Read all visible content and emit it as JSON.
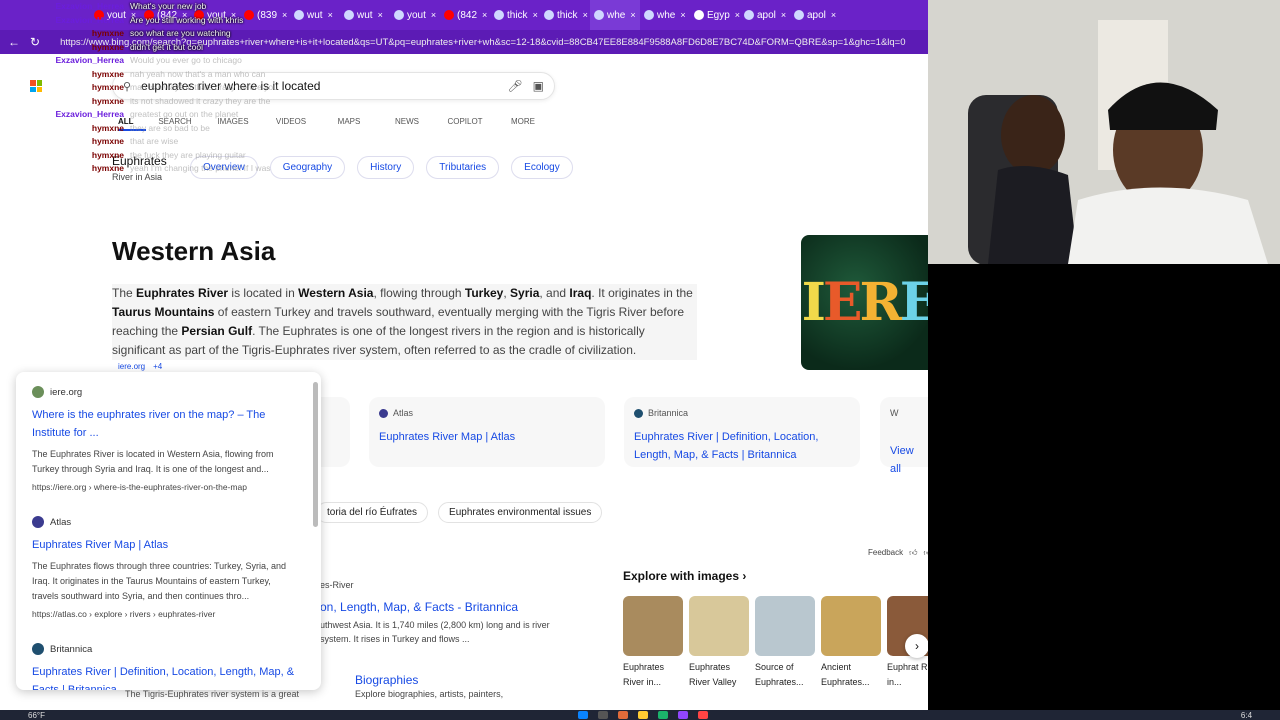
{
  "browser": {
    "tabs": [
      {
        "label": "yout",
        "icon_color": "#ff0000"
      },
      {
        "label": "(842",
        "icon_color": "#ff0000"
      },
      {
        "label": "yout",
        "icon_color": "#ff0000"
      },
      {
        "label": "(839",
        "icon_color": "#ff0000"
      },
      {
        "label": "wut",
        "icon_color": "#cfd8ff"
      },
      {
        "label": "wut",
        "icon_color": "#cfd8ff"
      },
      {
        "label": "yout",
        "icon_color": "#cfd8ff"
      },
      {
        "label": "(842",
        "icon_color": "#ff0000"
      },
      {
        "label": "thick",
        "icon_color": "#cfd8ff"
      },
      {
        "label": "thick",
        "icon_color": "#cfd8ff"
      },
      {
        "label": "whe",
        "icon_color": "#cfd8ff"
      },
      {
        "label": "whe",
        "icon_color": "#cfd8ff"
      },
      {
        "label": "Egyp",
        "icon_color": "#ffffff"
      },
      {
        "label": "apol",
        "icon_color": "#cfd8ff"
      },
      {
        "label": "apol",
        "icon_color": "#cfd8ff"
      }
    ],
    "url": "https://www.bing.com/search?q=euphrates+river+where+is+it+located&qs=UT&pq=euphrates+river+wh&sc=12-18&cvid=88CB47EE8E884F9588A8FD6D8E7BC74D&FORM=QBRE&sp=1&ghc=1&lq=0"
  },
  "bing": {
    "query": "euphrates river where is it located",
    "scopes": [
      "ALL",
      "SEARCH",
      "IMAGES",
      "VIDEOS",
      "MAPS",
      "NEWS",
      "COPILOT",
      "MORE"
    ],
    "entity_title": "Euphrates",
    "entity_sub": "River in Asia",
    "pills": [
      "Overview",
      "Geography",
      "History",
      "Tributaries",
      "Ecology"
    ],
    "answer": "Western Asia",
    "paragraph": {
      "p1": "The ",
      "b1": "Euphrates River",
      "p2": " is located in ",
      "b2": "Western Asia",
      "p3": ", flowing through ",
      "b3": "Turkey",
      "p4": ", ",
      "b4": "Syria",
      "p5": ", and ",
      "b5": "Iraq",
      "p6": ". It originates in the ",
      "b6": "Taurus Mountains",
      "p7": " of eastern Turkey and travels southward, eventually merging with the Tigris River before reaching the ",
      "b7": "Persian Gulf",
      "p8": ". The Euphrates is one of the longest rivers in the region and is historically significant as part of the Tigris-Euphrates river system, often referred to as the cradle of civilization."
    },
    "citations": [
      "iere.org",
      "+4"
    ],
    "thumb_text": "IERE",
    "cards": [
      {
        "source": "",
        "title": "? –"
      },
      {
        "source": "Atlas",
        "title": "Euphrates River Map | Atlas"
      },
      {
        "source": "Britannica",
        "title": "Euphrates River | Definition, Location, Length, Map, & Facts | Britannica"
      },
      {
        "source": "W",
        "title": "View all"
      }
    ],
    "related": [
      "toria del río Éufrates",
      "Euphrates environmental issues"
    ],
    "feedback": "Feedback",
    "explore_title": "Explore with images",
    "images": [
      {
        "caption": "Euphrates River in...",
        "color": "#a98b5e"
      },
      {
        "caption": "Euphrates River Valley",
        "color": "#d8c89a"
      },
      {
        "caption": "Source of Euphrates...",
        "color": "#b9c7cf"
      },
      {
        "caption": "Ancient Euphrates...",
        "color": "#c9a55b"
      },
      {
        "caption": "Euphrat River in...",
        "color": "#8a5a3a"
      }
    ],
    "lower": {
      "src": "es-River",
      "title": "on, Length, Map, & Facts - Britannica",
      "body": "uthwest Asia. It is 1,740 miles (2,800 km) long and is river system. It rises in Turkey and flows ...",
      "bio_title": "Biographies",
      "bio_sub": "Explore biographies, artists, painters,",
      "foot": "The Tigris-Euphrates river system is a great"
    }
  },
  "popup": [
    {
      "source": "iere.org",
      "title": "Where is the euphrates river on the map? – The Institute for ...",
      "body": "The Euphrates River is located in Western Asia, flowing from Turkey through Syria and Iraq. It is one of the longest and...",
      "url": "https://iere.org › where-is-the-euphrates-river-on-the-map",
      "color": "#6b8f5a"
    },
    {
      "source": "Atlas",
      "title": "Euphrates River Map | Atlas",
      "body": "The Euphrates flows through three countries: Turkey, Syria, and Iraq. It originates in the Taurus Mountains of eastern Turkey, travels southward into Syria, and then continues thro...",
      "url": "https://atlas.co › explore › rivers › euphrates-river",
      "color": "#3b3b8f"
    },
    {
      "source": "Britannica",
      "title": "Euphrates River | Definition, Location, Length, Map, & Facts | Britannica",
      "body": "",
      "url": "",
      "color": "#1f4f6f"
    }
  ],
  "chat": [
    {
      "user": "Exzavion_Herrea",
      "text": "What's your new job",
      "hym": false,
      "dim": false
    },
    {
      "user": "Exzavion_Herrea",
      "text": "Are you still working with khris",
      "hym": false,
      "dim": false
    },
    {
      "user": "hymxne",
      "text": "soo what are you watching",
      "hym": true,
      "dim": false
    },
    {
      "user": "hymxne",
      "text": "didn't get it but cool",
      "hym": true,
      "dim": false
    },
    {
      "user": "Exzavion_Herrea",
      "text": "Would you ever go to chicago",
      "hym": false,
      "dim": true
    },
    {
      "user": "hymxne",
      "text": "nah yeah now that's a man who can",
      "hym": true,
      "dim": true
    },
    {
      "user": "hymxne",
      "text": "man is always lit thats crazy before you",
      "hym": true,
      "dim": true
    },
    {
      "user": "hymxne",
      "text": "its not shadowed it crazy they are the",
      "hym": true,
      "dim": true
    },
    {
      "user": "Exzavion_Herrea",
      "text": "greatest go out on the planet",
      "hym": false,
      "dim": true
    },
    {
      "user": "hymxne",
      "text": "they are so bad to be",
      "hym": true,
      "dim": true
    },
    {
      "user": "hymxne",
      "text": "that are wise",
      "hym": true,
      "dim": true
    },
    {
      "user": "hymxne",
      "text": "the fuck they are playing guitar",
      "hym": true,
      "dim": true
    },
    {
      "user": "hymxne",
      "text": "yeah I'm changing the phone! If I was",
      "hym": true,
      "dim": true
    }
  ],
  "taskbar": {
    "weather": "66°F",
    "time": "6:4"
  }
}
